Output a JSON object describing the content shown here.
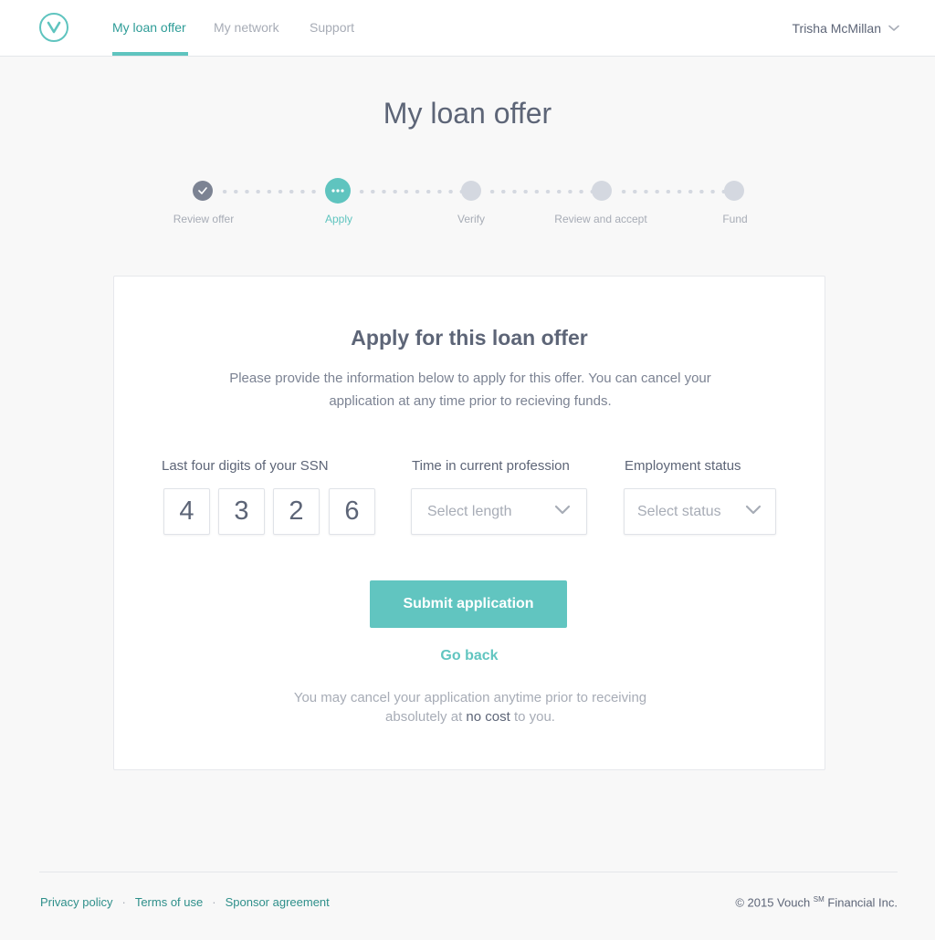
{
  "header": {
    "logo_icon": "vouch-logo-icon",
    "tabs": [
      {
        "label": "My loan offer",
        "active": true
      },
      {
        "label": "My network",
        "active": false
      },
      {
        "label": "Support",
        "active": false
      }
    ],
    "user_name": "Trisha McMillan"
  },
  "page": {
    "title": "My loan offer"
  },
  "stepper": {
    "steps": [
      {
        "label": "Review offer",
        "state": "done"
      },
      {
        "label": "Apply",
        "state": "current"
      },
      {
        "label": "Verify",
        "state": "upcoming"
      },
      {
        "label": "Review and accept",
        "state": "upcoming"
      },
      {
        "label": "Fund",
        "state": "upcoming"
      }
    ]
  },
  "form": {
    "title": "Apply for this loan offer",
    "description": "Please provide the information below to apply for this offer. You can cancel your application at any time prior to recieving funds.",
    "ssn_label": "Last four digits of your SSN",
    "ssn_digits": [
      "4",
      "3",
      "2",
      "6"
    ],
    "profession_label": "Time in current profession",
    "profession_placeholder": "Select length",
    "employment_label": "Employment status",
    "employment_placeholder": "Select status",
    "submit_label": "Submit application",
    "back_label": "Go back",
    "note_before": "You may cancel your application anytime prior to receiving absolutely at ",
    "note_emphasis": "no cost",
    "note_after": " to you."
  },
  "footer": {
    "links": [
      "Privacy policy",
      "Terms of use",
      "Sponsor agreement"
    ],
    "separator": "·",
    "copyright_pre": "© 2015 Vouch ",
    "copyright_mark": "SM",
    "copyright_post": " Financial Inc."
  },
  "colors": {
    "accent": "#5fc4bf",
    "accent_dark": "#2e9c97",
    "text": "#5d6577",
    "muted": "#a7acb6"
  }
}
